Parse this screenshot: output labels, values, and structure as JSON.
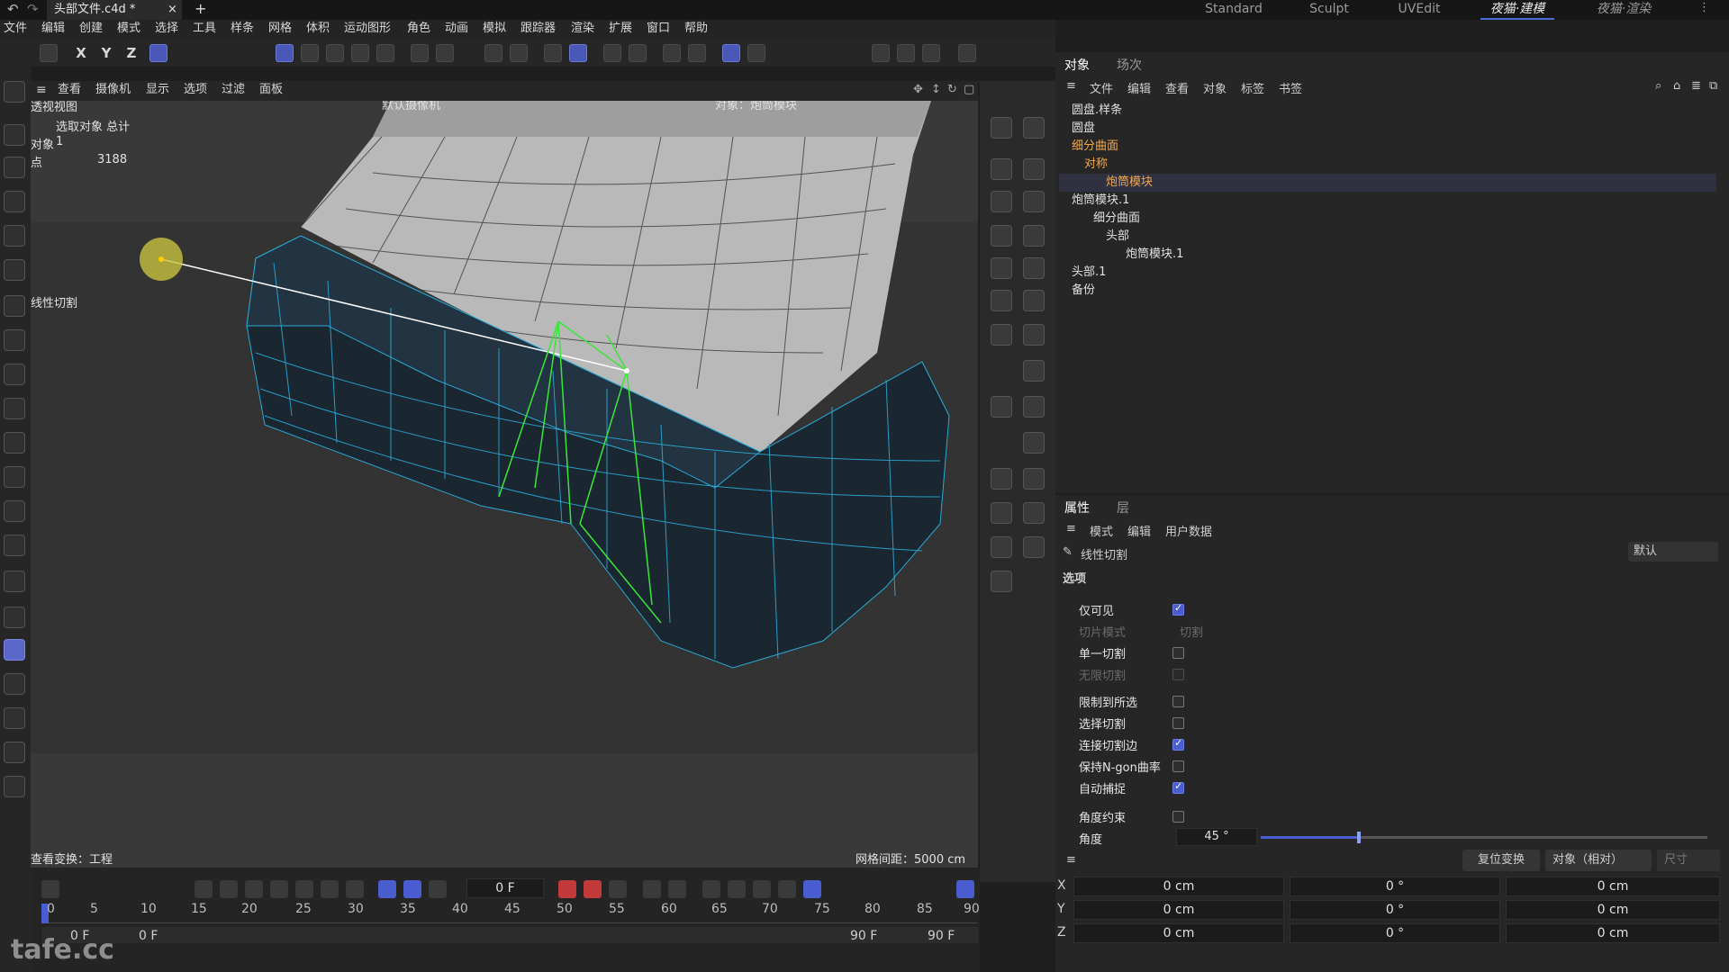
{
  "tabs": {
    "file_title": "头部文件.c4d *",
    "close": "×",
    "add": "+"
  },
  "workspaces": [
    "Standard",
    "Sculpt",
    "UVEdit",
    "夜猫·建模",
    "夜猫·渲染"
  ],
  "menu": [
    "文件",
    "编辑",
    "创建",
    "模式",
    "选择",
    "工具",
    "样条",
    "网格",
    "体积",
    "运动图形",
    "角色",
    "动画",
    "模拟",
    "跟踪器",
    "渲染",
    "扩展",
    "窗口",
    "帮助"
  ],
  "toolbar": {
    "x": "X",
    "y": "Y",
    "z": "Z"
  },
  "viewport": {
    "menu": [
      "查看",
      "摄像机",
      "显示",
      "选项",
      "过滤",
      "面板"
    ],
    "title": "透视视图",
    "camera": "默认摄像机",
    "object_label": "对象：炮筒模块",
    "stats_header": "选取对象 总计",
    "stats": [
      {
        "k": "对象",
        "v": "1"
      },
      {
        "k": "点",
        "v": "3188"
      }
    ],
    "tool_label": "线性切割",
    "view_transform": "查看变换：工程",
    "grid_spacing": "网格间距：5000 cm"
  },
  "objects_panel": {
    "tabs": [
      "对象",
      "场次"
    ],
    "menu": [
      "文件",
      "编辑",
      "查看",
      "对象",
      "标签",
      "书签"
    ],
    "items": [
      {
        "name": "圆盘.样条",
        "indent": 0,
        "highlight": false
      },
      {
        "name": "圆盘",
        "indent": 0,
        "highlight": false
      },
      {
        "name": "细分曲面",
        "indent": 0,
        "highlight": true
      },
      {
        "name": "对称",
        "indent": 1,
        "highlight": true
      },
      {
        "name": "炮筒模块",
        "indent": 2,
        "highlight": true
      },
      {
        "name": "炮筒模块.1",
        "indent": 0,
        "highlight": false
      },
      {
        "name": "细分曲面",
        "indent": 1,
        "highlight": false
      },
      {
        "name": "头部",
        "indent": 2,
        "highlight": false
      },
      {
        "name": "炮筒模块.1",
        "indent": 3,
        "highlight": false
      },
      {
        "name": "头部.1",
        "indent": 0,
        "highlight": false
      },
      {
        "name": "备份",
        "indent": 0,
        "highlight": false
      }
    ]
  },
  "attributes": {
    "tabs": [
      "属性",
      "层"
    ],
    "menu": [
      "模式",
      "编辑",
      "用户数据"
    ],
    "tool": "线性切割",
    "preset": "默认",
    "section": "选项",
    "options": [
      {
        "label": "仅可见",
        "checked": true,
        "dim": false
      },
      {
        "label": "切片模式",
        "value": "切割",
        "dim": true
      },
      {
        "label": "单一切割",
        "checked": false,
        "dim": false
      },
      {
        "label": "无限切割",
        "checked": false,
        "dim": true
      },
      {
        "label": "限制到所选",
        "checked": false,
        "dim": false
      },
      {
        "label": "选择切割",
        "checked": false,
        "dim": false
      },
      {
        "label": "连接切割边",
        "checked": true,
        "dim": false
      },
      {
        "label": "保持N-gon曲率",
        "checked": false,
        "dim": false
      },
      {
        "label": "自动捕捉",
        "checked": true,
        "dim": false
      },
      {
        "label": "角度约束",
        "checked": false,
        "dim": false
      }
    ],
    "angle_label": "角度",
    "angle_value": "45 °",
    "angle_fraction": 0.22
  },
  "coords": {
    "reset": "复位变换",
    "mode": "对象（相对）",
    "size": "尺寸",
    "rows": [
      {
        "axis": "X",
        "pos": "0 cm",
        "rot": "0 °",
        "scale": "0 cm"
      },
      {
        "axis": "Y",
        "pos": "0 cm",
        "rot": "0 °",
        "scale": "0 cm"
      },
      {
        "axis": "Z",
        "pos": "0 cm",
        "rot": "0 °",
        "scale": "0 cm"
      }
    ]
  },
  "timeline": {
    "current": "0 F",
    "ticks": [
      "0",
      "5",
      "10",
      "15",
      "20",
      "25",
      "30",
      "35",
      "40",
      "45",
      "50",
      "55",
      "60",
      "65",
      "70",
      "75",
      "80",
      "85",
      "90"
    ],
    "start": "0 F",
    "start2": "0 F",
    "end": "90 F",
    "end2": "90 F"
  },
  "watermark": "tafe.cc",
  "colors": {
    "accent": "#4a5dd0",
    "highlight": "#f2a84a",
    "cut_line": "#39e639",
    "wire": "#2aa9d6"
  }
}
